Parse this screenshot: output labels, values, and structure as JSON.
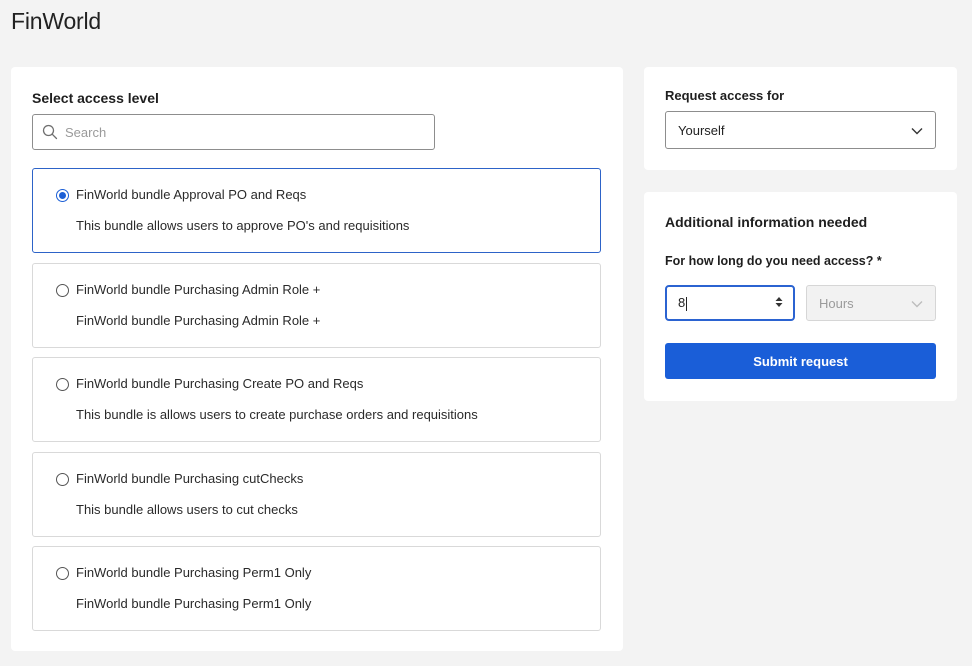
{
  "app": {
    "title": "FinWorld"
  },
  "access_level": {
    "heading": "Select access level",
    "search_placeholder": "Search",
    "search_value": "",
    "options": [
      {
        "title": "FinWorld bundle Approval PO and Reqs",
        "description": "This bundle allows users to approve PO's and requisitions",
        "selected": true
      },
      {
        "title": "FinWorld bundle Purchasing Admin Role +",
        "description": "FinWorld bundle Purchasing Admin Role +",
        "selected": false
      },
      {
        "title": "FinWorld bundle Purchasing Create PO and Reqs",
        "description": "This bundle is allows users to create purchase orders and requisitions",
        "selected": false
      },
      {
        "title": "FinWorld bundle Purchasing cutChecks",
        "description": "This bundle allows users to cut checks",
        "selected": false
      },
      {
        "title": "FinWorld bundle Purchasing Perm1 Only",
        "description": "FinWorld bundle Purchasing Perm1 Only",
        "selected": false
      }
    ]
  },
  "request_for": {
    "label": "Request access for",
    "value": "Yourself"
  },
  "additional_info": {
    "heading": "Additional information needed",
    "duration_label": "For how long do you need access? *",
    "duration_value": "8",
    "unit_value": "Hours",
    "submit_label": "Submit request"
  },
  "colors": {
    "accent": "#1a5ed8",
    "page_background": "#f3f3f3",
    "panel_background": "#ffffff"
  },
  "icons": {
    "search": "search-icon",
    "dropdown": "chevron-down-icon",
    "stepper": "stepper-arrows-icon"
  }
}
